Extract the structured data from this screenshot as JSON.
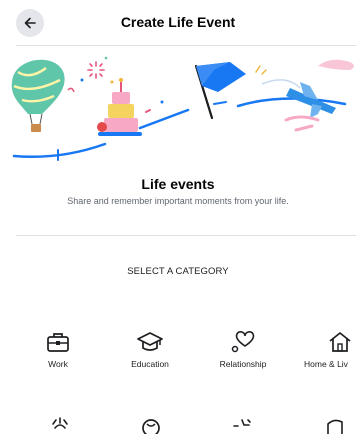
{
  "header": {
    "title": "Create Life Event"
  },
  "intro": {
    "title": "Life events",
    "subtitle": "Share and remember important moments from your life."
  },
  "categories": {
    "heading": "SELECT A CATEGORY",
    "items": [
      {
        "label": "Work",
        "icon": "briefcase-icon"
      },
      {
        "label": "Education",
        "icon": "graduation-cap-icon"
      },
      {
        "label": "Relationship",
        "icon": "heart-icon"
      },
      {
        "label": "Home & Liv",
        "icon": "home-icon"
      }
    ]
  },
  "colors": {
    "text": "#050505",
    "muted": "#606770",
    "flag": "#1877f2",
    "balloon": "#5fc6a9"
  }
}
